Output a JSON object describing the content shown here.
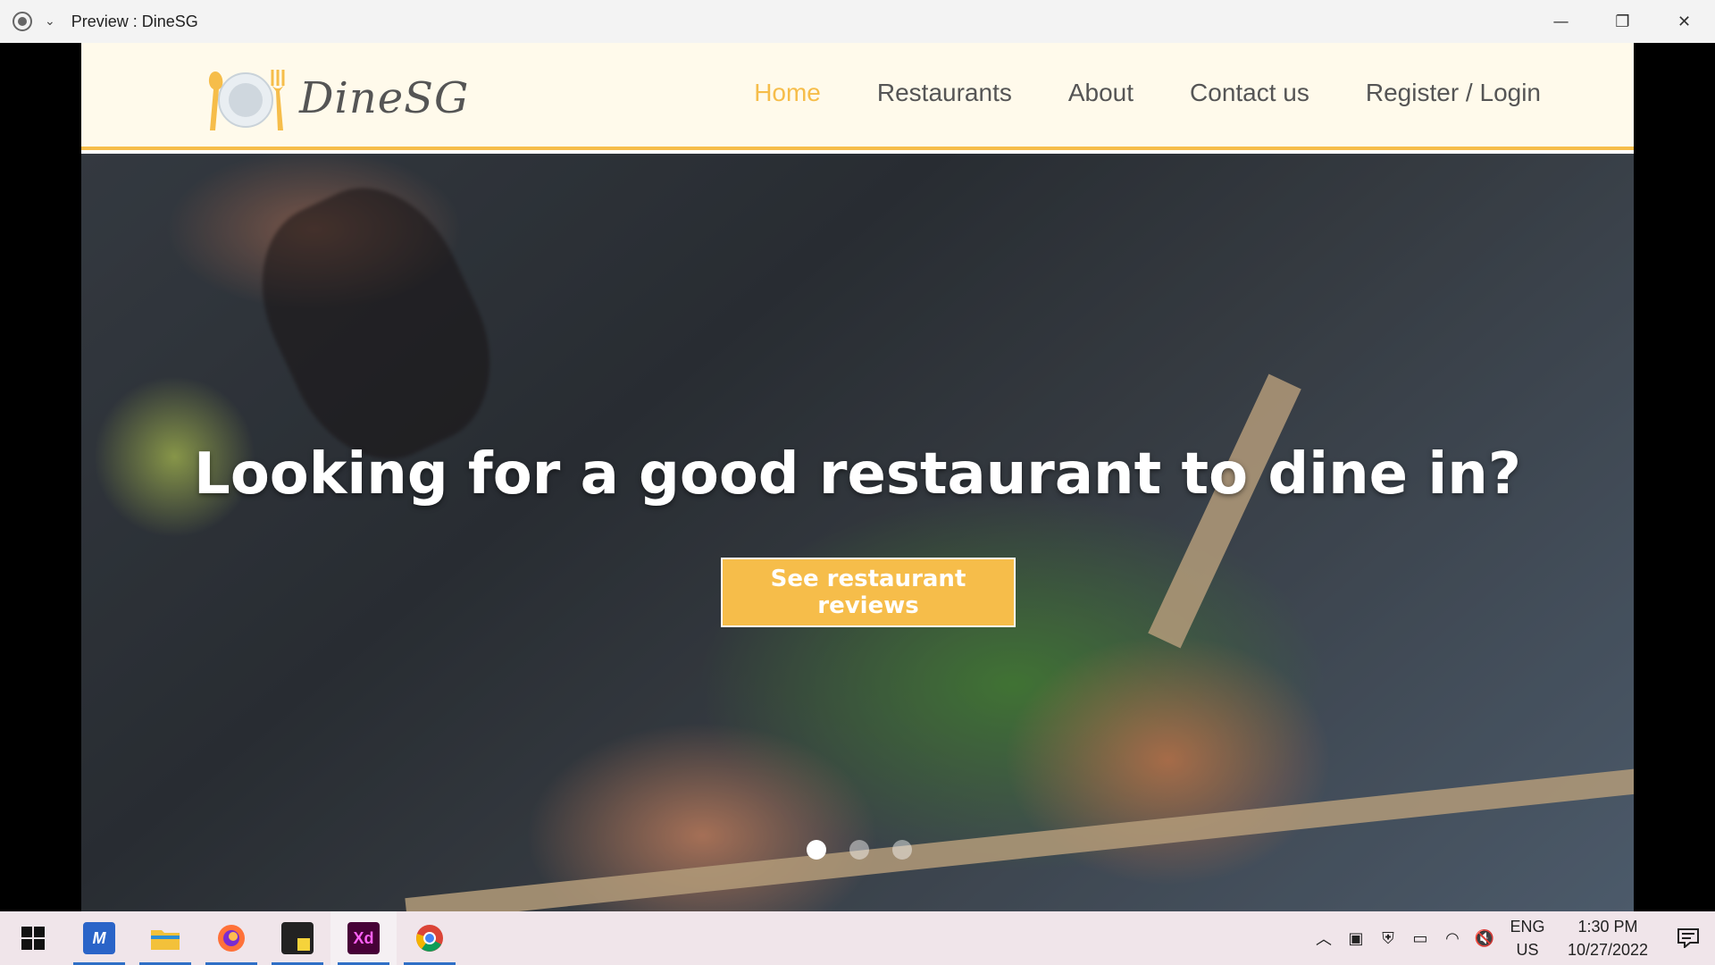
{
  "window": {
    "title": "Preview : DineSG",
    "controls": {
      "minimize": "—",
      "restore": "❐",
      "close": "✕"
    }
  },
  "site": {
    "logo_text": "DineSG",
    "nav": [
      {
        "label": "Home",
        "active": true
      },
      {
        "label": "Restaurants",
        "active": false
      },
      {
        "label": "About",
        "active": false
      },
      {
        "label": "Contact us",
        "active": false
      },
      {
        "label": "Register / Login",
        "active": false
      }
    ],
    "hero": {
      "title": "Looking for a good restaurant to dine in?",
      "cta": "See restaurant reviews",
      "slides": 3,
      "active_slide": 1
    },
    "colors": {
      "accent": "#f6bd4a",
      "nav_bg": "#fffaeb",
      "text": "#555555"
    }
  },
  "taskbar": {
    "apps": [
      {
        "name": "start",
        "icon": "windows-icon"
      },
      {
        "name": "ide",
        "icon": "ide-icon",
        "active": true
      },
      {
        "name": "file-explorer",
        "icon": "folder-icon",
        "active": true
      },
      {
        "name": "firefox",
        "icon": "firefox-icon",
        "active": true
      },
      {
        "name": "sticky-notes",
        "icon": "sticky-notes-icon",
        "active": true
      },
      {
        "name": "adobe-xd",
        "icon": "adobe-xd-icon",
        "label": "Xd",
        "active": true,
        "selected": true
      },
      {
        "name": "chrome",
        "icon": "chrome-icon",
        "active": true
      }
    ],
    "tray": {
      "lang_top": "ENG",
      "lang_bottom": "US",
      "time": "1:30 PM",
      "date": "10/27/2022"
    }
  }
}
